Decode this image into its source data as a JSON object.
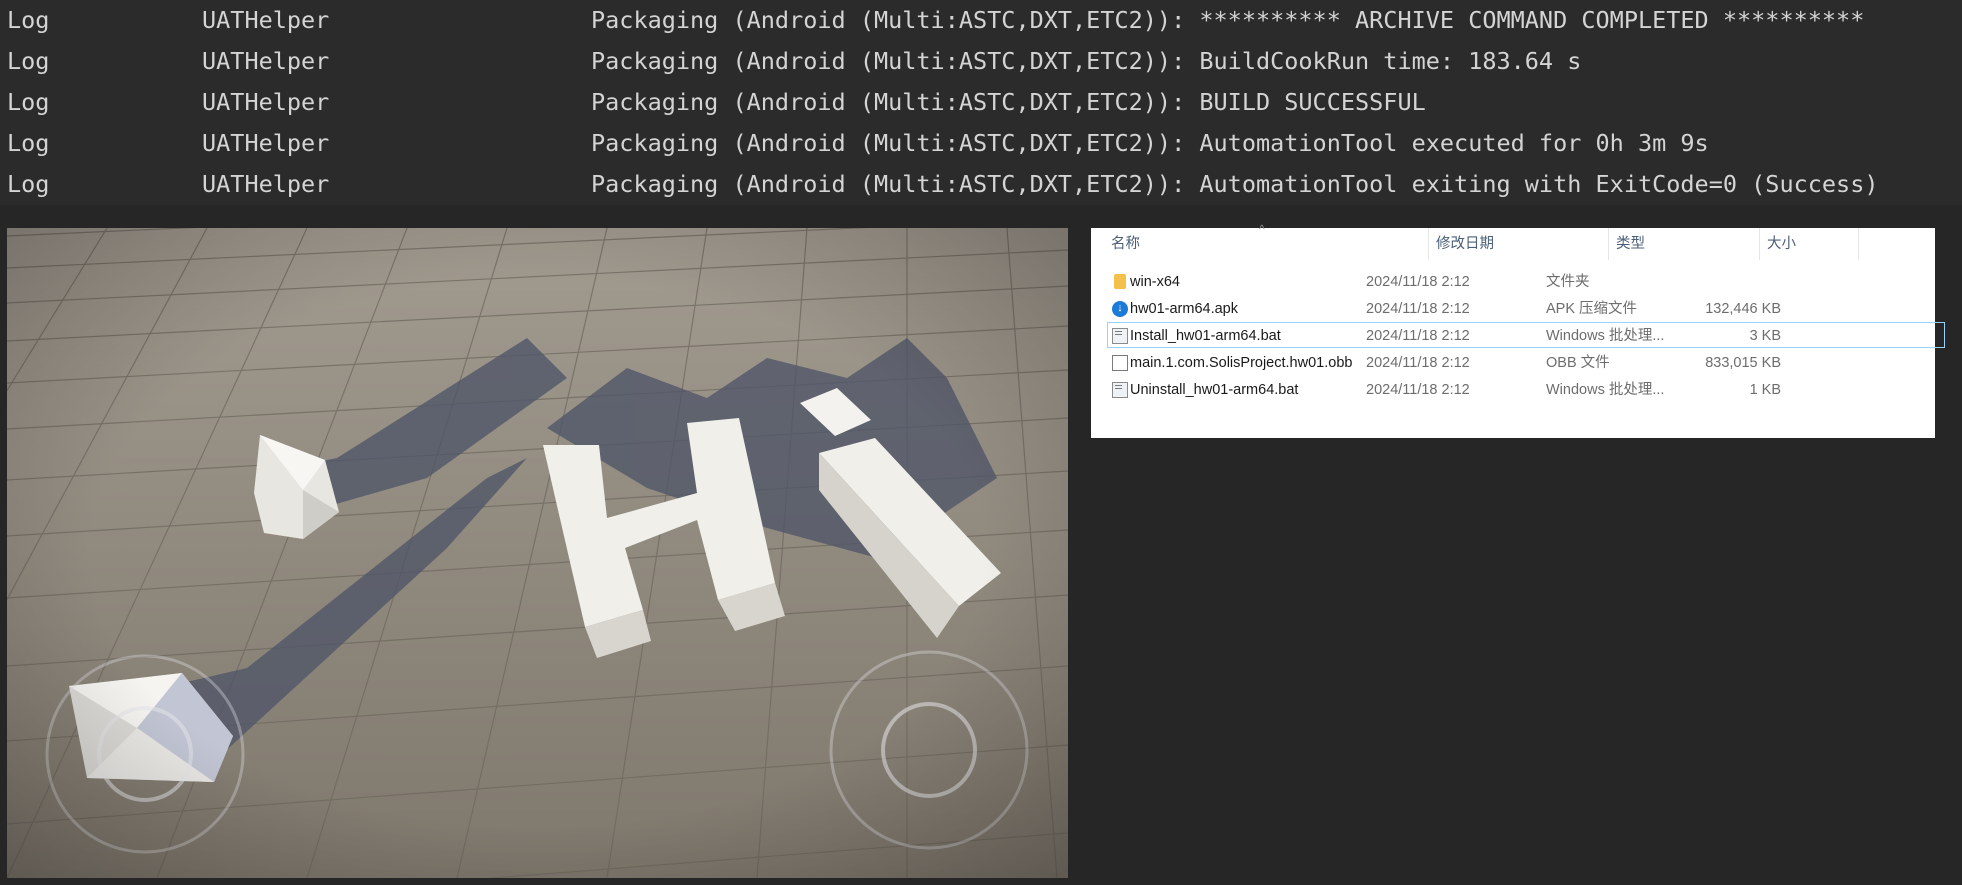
{
  "log": {
    "rows": [
      {
        "verbosity": "Log",
        "category": "UATHelper",
        "message": "Packaging (Android (Multi:ASTC,DXT,ETC2)): ********** ARCHIVE COMMAND COMPLETED **********"
      },
      {
        "verbosity": "Log",
        "category": "UATHelper",
        "message": "Packaging (Android (Multi:ASTC,DXT,ETC2)): BuildCookRun time: 183.64 s"
      },
      {
        "verbosity": "Log",
        "category": "UATHelper",
        "message": "Packaging (Android (Multi:ASTC,DXT,ETC2)): BUILD SUCCESSFUL"
      },
      {
        "verbosity": "Log",
        "category": "UATHelper",
        "message": "Packaging (Android (Multi:ASTC,DXT,ETC2)): AutomationTool executed for 0h 3m 9s"
      },
      {
        "verbosity": "Log",
        "category": "UATHelper",
        "message": "Packaging (Android (Multi:ASTC,DXT,ETC2)): AutomationTool exiting with ExitCode=0 (Success)"
      }
    ]
  },
  "viewport": {
    "scene_text": "Hi",
    "colors": {
      "floor": "#8b8478",
      "tile_line": "#6e685f",
      "object": "#f1efea",
      "shadow": "#4f5668"
    }
  },
  "explorer": {
    "columns": {
      "name": "名称",
      "modified": "修改日期",
      "type": "类型",
      "size": "大小"
    },
    "files": [
      {
        "name": "win-x64",
        "modified": "2024/11/18 2:12",
        "type": "文件夹",
        "size": "",
        "icon": "folder-icon"
      },
      {
        "name": "hw01-arm64.apk",
        "modified": "2024/11/18 2:12",
        "type": "APK 压缩文件",
        "size": "132,446 KB",
        "icon": "apk-icon"
      },
      {
        "name": "Install_hw01-arm64.bat",
        "modified": "2024/11/18 2:12",
        "type": "Windows 批处理...",
        "size": "3 KB",
        "icon": "batch-file-icon",
        "selected": true
      },
      {
        "name": "main.1.com.SolisProject.hw01.obb",
        "modified": "2024/11/18 2:12",
        "type": "OBB 文件",
        "size": "833,015 KB",
        "icon": "file-icon"
      },
      {
        "name": "Uninstall_hw01-arm64.bat",
        "modified": "2024/11/18 2:12",
        "type": "Windows 批处理...",
        "size": "1 KB",
        "icon": "batch-file-icon"
      }
    ]
  }
}
